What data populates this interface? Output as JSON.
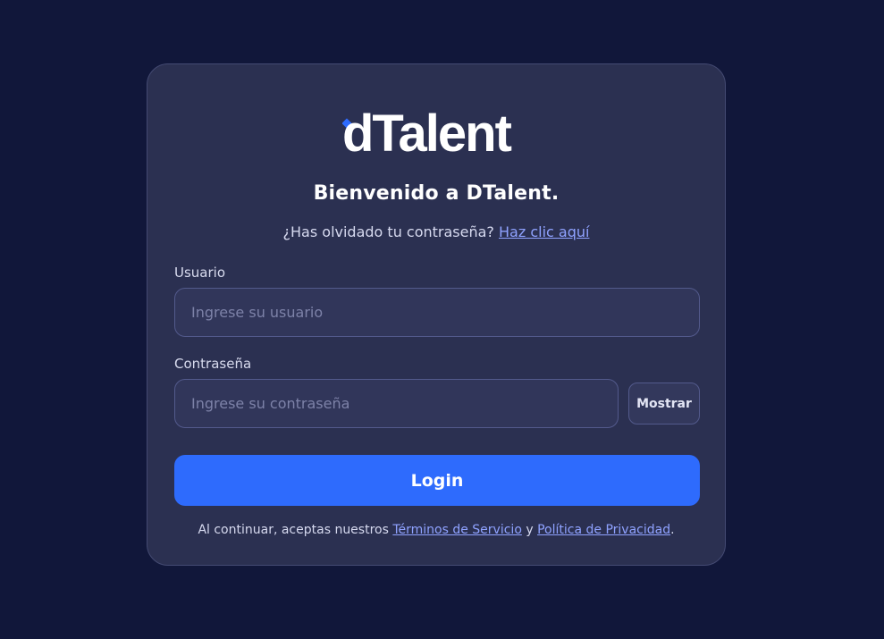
{
  "brand": {
    "logo_text": "dTalent",
    "accent_color": "#2e6bfd"
  },
  "login": {
    "title": "Bienvenido a DTalent.",
    "forgot_prefix": "¿Has olvidado tu contraseña?",
    "forgot_link": "Haz clic aquí",
    "username": {
      "label": "Usuario",
      "placeholder": "Ingrese su usuario",
      "value": ""
    },
    "password": {
      "label": "Contraseña",
      "placeholder": "Ingrese su contraseña",
      "value": ""
    },
    "show_button": "Mostrar",
    "login_button": "Login",
    "terms": {
      "prefix": "Al continuar, aceptas nuestros",
      "terms_link": "Términos de Servicio",
      "conjunction": "y",
      "privacy_link": "Política de Privacidad",
      "suffix": "."
    }
  }
}
